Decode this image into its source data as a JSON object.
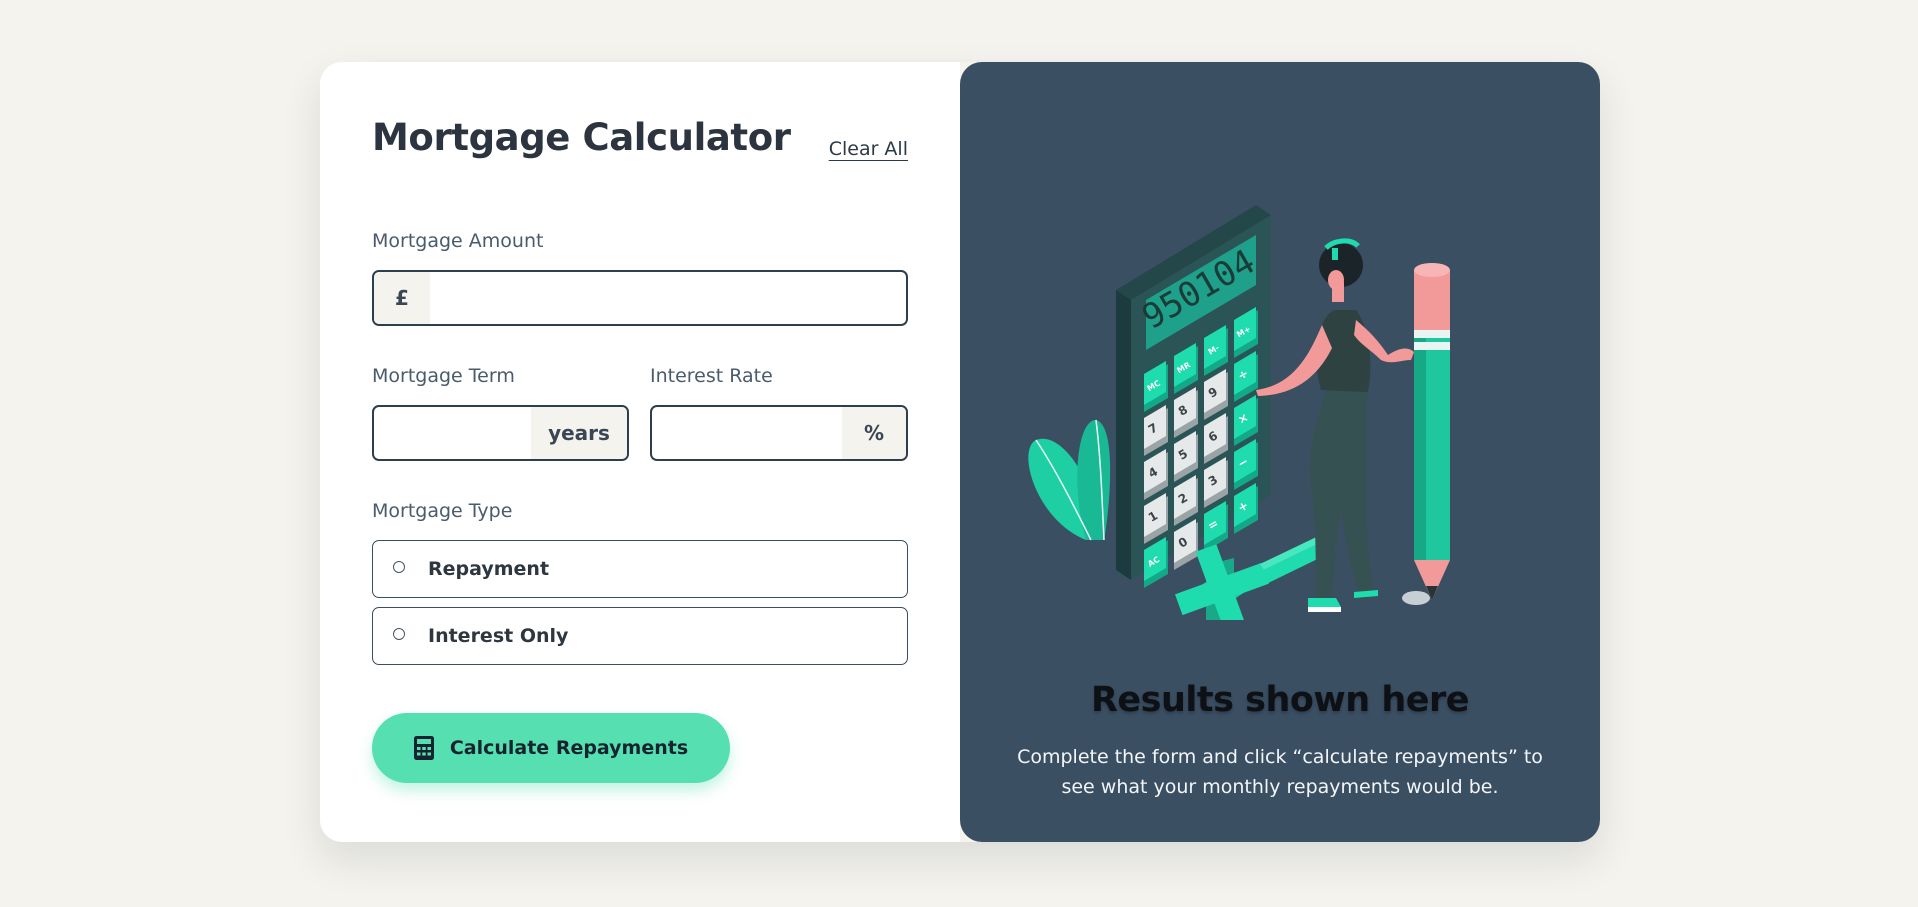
{
  "calculator": {
    "title": "Mortgage Calculator",
    "clear_all_label": "Clear All",
    "amount": {
      "label": "Mortgage Amount",
      "prefix": "£",
      "value": ""
    },
    "term": {
      "label": "Mortgage Term",
      "suffix": "years",
      "value": ""
    },
    "rate": {
      "label": "Interest Rate",
      "suffix": "%",
      "value": ""
    },
    "type": {
      "label": "Mortgage Type",
      "options": [
        {
          "label": "Repayment",
          "selected": false
        },
        {
          "label": "Interest Only",
          "selected": false
        }
      ]
    },
    "submit": {
      "label": "Calculate Repayments",
      "icon": "calculator-icon"
    }
  },
  "results": {
    "title": "Results shown here",
    "description": "Complete the form and click “calculate repayments” to see what your monthly repayments would be.",
    "illustration": {
      "name": "calculator-illustration",
      "display": "950104",
      "keys": [
        "MC",
        "MR",
        "M-",
        "M+",
        "7",
        "8",
        "9",
        "÷",
        "4",
        "5",
        "6",
        "×",
        "1",
        "2",
        "3",
        "−",
        "AC",
        "0",
        "=",
        "+"
      ]
    }
  },
  "colors": {
    "page_background": "#f4f3ee",
    "panel_dark": "#3b4f63",
    "accent_lime": "#56dfb0",
    "text_dark": "#2c3440",
    "border": "#2f3e4e"
  }
}
